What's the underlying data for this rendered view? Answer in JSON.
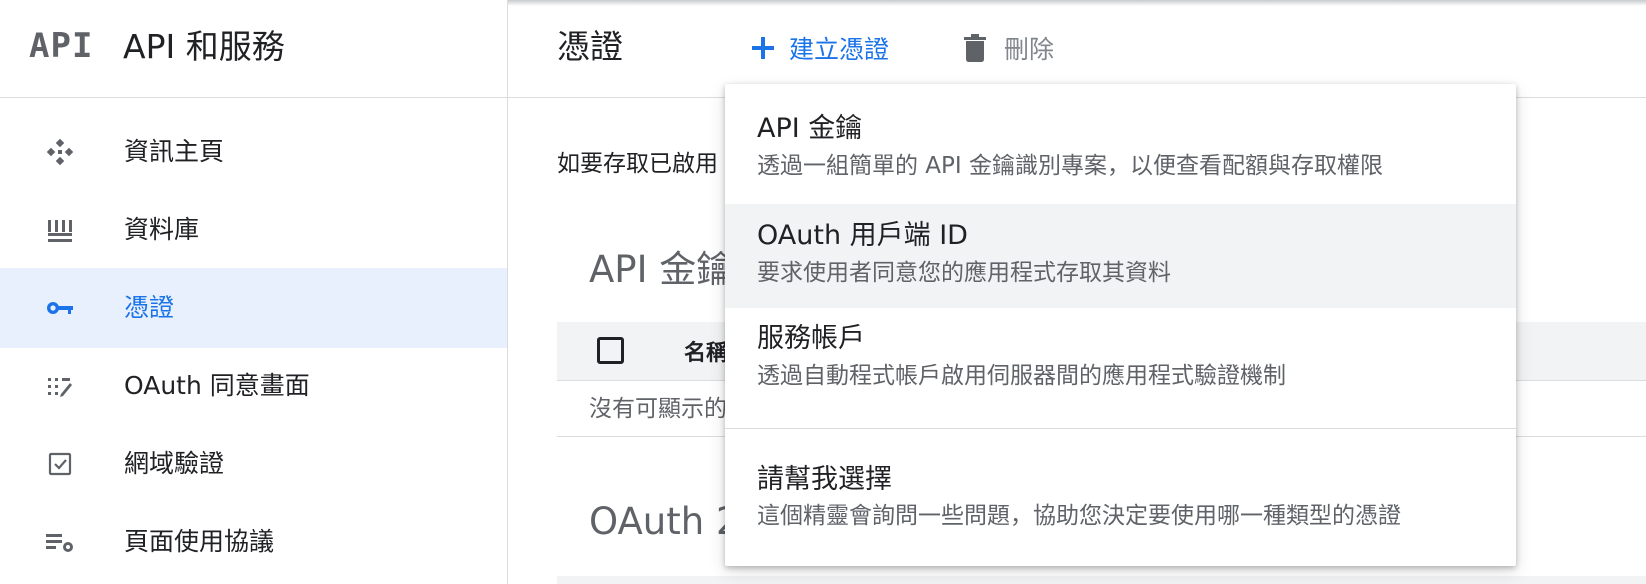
{
  "sidebar": {
    "logo": "API",
    "title": "API 和服務",
    "items": [
      {
        "label": "資訊主頁",
        "icon": "dashboard-icon"
      },
      {
        "label": "資料庫",
        "icon": "library-icon"
      },
      {
        "label": "憑證",
        "icon": "key-icon",
        "active": true
      },
      {
        "label": "OAuth 同意畫面",
        "icon": "consent-icon"
      },
      {
        "label": "網域驗證",
        "icon": "domain-check-icon"
      },
      {
        "label": "頁面使用協議",
        "icon": "settings-list-icon"
      }
    ]
  },
  "toolbar": {
    "title": "憑證",
    "create_label": "建立憑證",
    "delete_label": "刪除"
  },
  "main": {
    "intro": "如要存取已啟用",
    "api_keys_title": "API 金鑰",
    "column_name": "名稱",
    "empty": "沒有可顯示的",
    "oauth_title": "OAuth 2"
  },
  "menu": {
    "items": [
      {
        "title": "API 金鑰",
        "description": "透過一組簡單的 API 金鑰識別專案，以便查看配額與存取權限"
      },
      {
        "title": "OAuth 用戶端 ID",
        "description": "要求使用者同意您的應用程式存取其資料"
      },
      {
        "title": "服務帳戶",
        "description": "透過自動程式帳戶啟用伺服器間的應用程式驗證機制"
      },
      {
        "title": "請幫我選擇",
        "description": "這個精靈會詢問一些問題，協助您決定要使用哪一種類型的憑證"
      }
    ]
  },
  "colors": {
    "accent": "#1a73e8",
    "active_bg": "#e8f0fe",
    "hover_bg": "#f1f3f4"
  }
}
